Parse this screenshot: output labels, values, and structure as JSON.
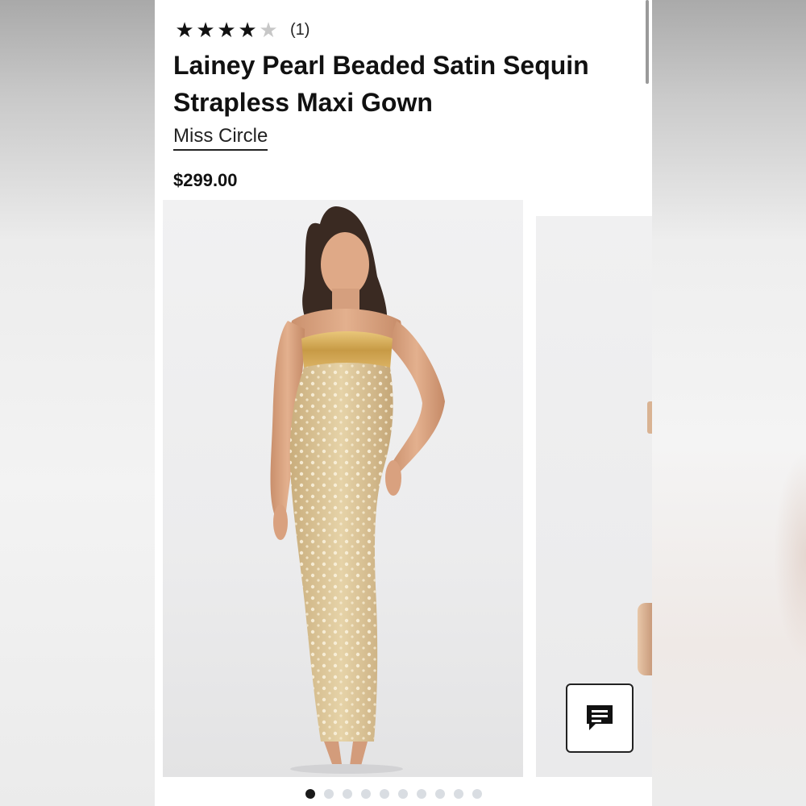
{
  "product": {
    "rating": {
      "stars_filled": 4,
      "stars_total": 5,
      "count_label": "(1)"
    },
    "title": "Lainey Pearl Beaded Satin Sequin Strapless Maxi Gown",
    "brand": "Miss Circle",
    "price": "$299.00"
  },
  "carousel": {
    "image_count": 10,
    "active_index": 0
  },
  "icons": {
    "star_filled": "star-icon",
    "star_empty": "star-outline-icon",
    "chat": "chat-icon"
  },
  "colors": {
    "text": "#111111",
    "star_filled": "#111111",
    "star_empty": "#c7c7c7",
    "dot_active": "#1a1a1a",
    "dot_inactive": "#d9dde2"
  }
}
